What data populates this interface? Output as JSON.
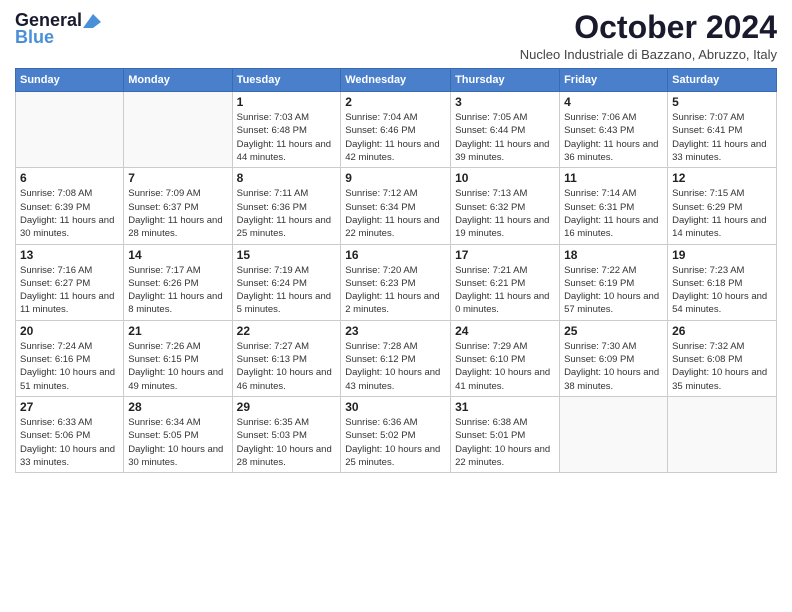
{
  "header": {
    "logo_general": "General",
    "logo_blue": "Blue",
    "month_title": "October 2024",
    "location": "Nucleo Industriale di Bazzano, Abruzzo, Italy"
  },
  "weekdays": [
    "Sunday",
    "Monday",
    "Tuesday",
    "Wednesday",
    "Thursday",
    "Friday",
    "Saturday"
  ],
  "weeks": [
    [
      {
        "day": "",
        "sunrise": "",
        "sunset": "",
        "daylight": ""
      },
      {
        "day": "",
        "sunrise": "",
        "sunset": "",
        "daylight": ""
      },
      {
        "day": "1",
        "sunrise": "Sunrise: 7:03 AM",
        "sunset": "Sunset: 6:48 PM",
        "daylight": "Daylight: 11 hours and 44 minutes."
      },
      {
        "day": "2",
        "sunrise": "Sunrise: 7:04 AM",
        "sunset": "Sunset: 6:46 PM",
        "daylight": "Daylight: 11 hours and 42 minutes."
      },
      {
        "day": "3",
        "sunrise": "Sunrise: 7:05 AM",
        "sunset": "Sunset: 6:44 PM",
        "daylight": "Daylight: 11 hours and 39 minutes."
      },
      {
        "day": "4",
        "sunrise": "Sunrise: 7:06 AM",
        "sunset": "Sunset: 6:43 PM",
        "daylight": "Daylight: 11 hours and 36 minutes."
      },
      {
        "day": "5",
        "sunrise": "Sunrise: 7:07 AM",
        "sunset": "Sunset: 6:41 PM",
        "daylight": "Daylight: 11 hours and 33 minutes."
      }
    ],
    [
      {
        "day": "6",
        "sunrise": "Sunrise: 7:08 AM",
        "sunset": "Sunset: 6:39 PM",
        "daylight": "Daylight: 11 hours and 30 minutes."
      },
      {
        "day": "7",
        "sunrise": "Sunrise: 7:09 AM",
        "sunset": "Sunset: 6:37 PM",
        "daylight": "Daylight: 11 hours and 28 minutes."
      },
      {
        "day": "8",
        "sunrise": "Sunrise: 7:11 AM",
        "sunset": "Sunset: 6:36 PM",
        "daylight": "Daylight: 11 hours and 25 minutes."
      },
      {
        "day": "9",
        "sunrise": "Sunrise: 7:12 AM",
        "sunset": "Sunset: 6:34 PM",
        "daylight": "Daylight: 11 hours and 22 minutes."
      },
      {
        "day": "10",
        "sunrise": "Sunrise: 7:13 AM",
        "sunset": "Sunset: 6:32 PM",
        "daylight": "Daylight: 11 hours and 19 minutes."
      },
      {
        "day": "11",
        "sunrise": "Sunrise: 7:14 AM",
        "sunset": "Sunset: 6:31 PM",
        "daylight": "Daylight: 11 hours and 16 minutes."
      },
      {
        "day": "12",
        "sunrise": "Sunrise: 7:15 AM",
        "sunset": "Sunset: 6:29 PM",
        "daylight": "Daylight: 11 hours and 14 minutes."
      }
    ],
    [
      {
        "day": "13",
        "sunrise": "Sunrise: 7:16 AM",
        "sunset": "Sunset: 6:27 PM",
        "daylight": "Daylight: 11 hours and 11 minutes."
      },
      {
        "day": "14",
        "sunrise": "Sunrise: 7:17 AM",
        "sunset": "Sunset: 6:26 PM",
        "daylight": "Daylight: 11 hours and 8 minutes."
      },
      {
        "day": "15",
        "sunrise": "Sunrise: 7:19 AM",
        "sunset": "Sunset: 6:24 PM",
        "daylight": "Daylight: 11 hours and 5 minutes."
      },
      {
        "day": "16",
        "sunrise": "Sunrise: 7:20 AM",
        "sunset": "Sunset: 6:23 PM",
        "daylight": "Daylight: 11 hours and 2 minutes."
      },
      {
        "day": "17",
        "sunrise": "Sunrise: 7:21 AM",
        "sunset": "Sunset: 6:21 PM",
        "daylight": "Daylight: 11 hours and 0 minutes."
      },
      {
        "day": "18",
        "sunrise": "Sunrise: 7:22 AM",
        "sunset": "Sunset: 6:19 PM",
        "daylight": "Daylight: 10 hours and 57 minutes."
      },
      {
        "day": "19",
        "sunrise": "Sunrise: 7:23 AM",
        "sunset": "Sunset: 6:18 PM",
        "daylight": "Daylight: 10 hours and 54 minutes."
      }
    ],
    [
      {
        "day": "20",
        "sunrise": "Sunrise: 7:24 AM",
        "sunset": "Sunset: 6:16 PM",
        "daylight": "Daylight: 10 hours and 51 minutes."
      },
      {
        "day": "21",
        "sunrise": "Sunrise: 7:26 AM",
        "sunset": "Sunset: 6:15 PM",
        "daylight": "Daylight: 10 hours and 49 minutes."
      },
      {
        "day": "22",
        "sunrise": "Sunrise: 7:27 AM",
        "sunset": "Sunset: 6:13 PM",
        "daylight": "Daylight: 10 hours and 46 minutes."
      },
      {
        "day": "23",
        "sunrise": "Sunrise: 7:28 AM",
        "sunset": "Sunset: 6:12 PM",
        "daylight": "Daylight: 10 hours and 43 minutes."
      },
      {
        "day": "24",
        "sunrise": "Sunrise: 7:29 AM",
        "sunset": "Sunset: 6:10 PM",
        "daylight": "Daylight: 10 hours and 41 minutes."
      },
      {
        "day": "25",
        "sunrise": "Sunrise: 7:30 AM",
        "sunset": "Sunset: 6:09 PM",
        "daylight": "Daylight: 10 hours and 38 minutes."
      },
      {
        "day": "26",
        "sunrise": "Sunrise: 7:32 AM",
        "sunset": "Sunset: 6:08 PM",
        "daylight": "Daylight: 10 hours and 35 minutes."
      }
    ],
    [
      {
        "day": "27",
        "sunrise": "Sunrise: 6:33 AM",
        "sunset": "Sunset: 5:06 PM",
        "daylight": "Daylight: 10 hours and 33 minutes."
      },
      {
        "day": "28",
        "sunrise": "Sunrise: 6:34 AM",
        "sunset": "Sunset: 5:05 PM",
        "daylight": "Daylight: 10 hours and 30 minutes."
      },
      {
        "day": "29",
        "sunrise": "Sunrise: 6:35 AM",
        "sunset": "Sunset: 5:03 PM",
        "daylight": "Daylight: 10 hours and 28 minutes."
      },
      {
        "day": "30",
        "sunrise": "Sunrise: 6:36 AM",
        "sunset": "Sunset: 5:02 PM",
        "daylight": "Daylight: 10 hours and 25 minutes."
      },
      {
        "day": "31",
        "sunrise": "Sunrise: 6:38 AM",
        "sunset": "Sunset: 5:01 PM",
        "daylight": "Daylight: 10 hours and 22 minutes."
      },
      {
        "day": "",
        "sunrise": "",
        "sunset": "",
        "daylight": ""
      },
      {
        "day": "",
        "sunrise": "",
        "sunset": "",
        "daylight": ""
      }
    ]
  ]
}
